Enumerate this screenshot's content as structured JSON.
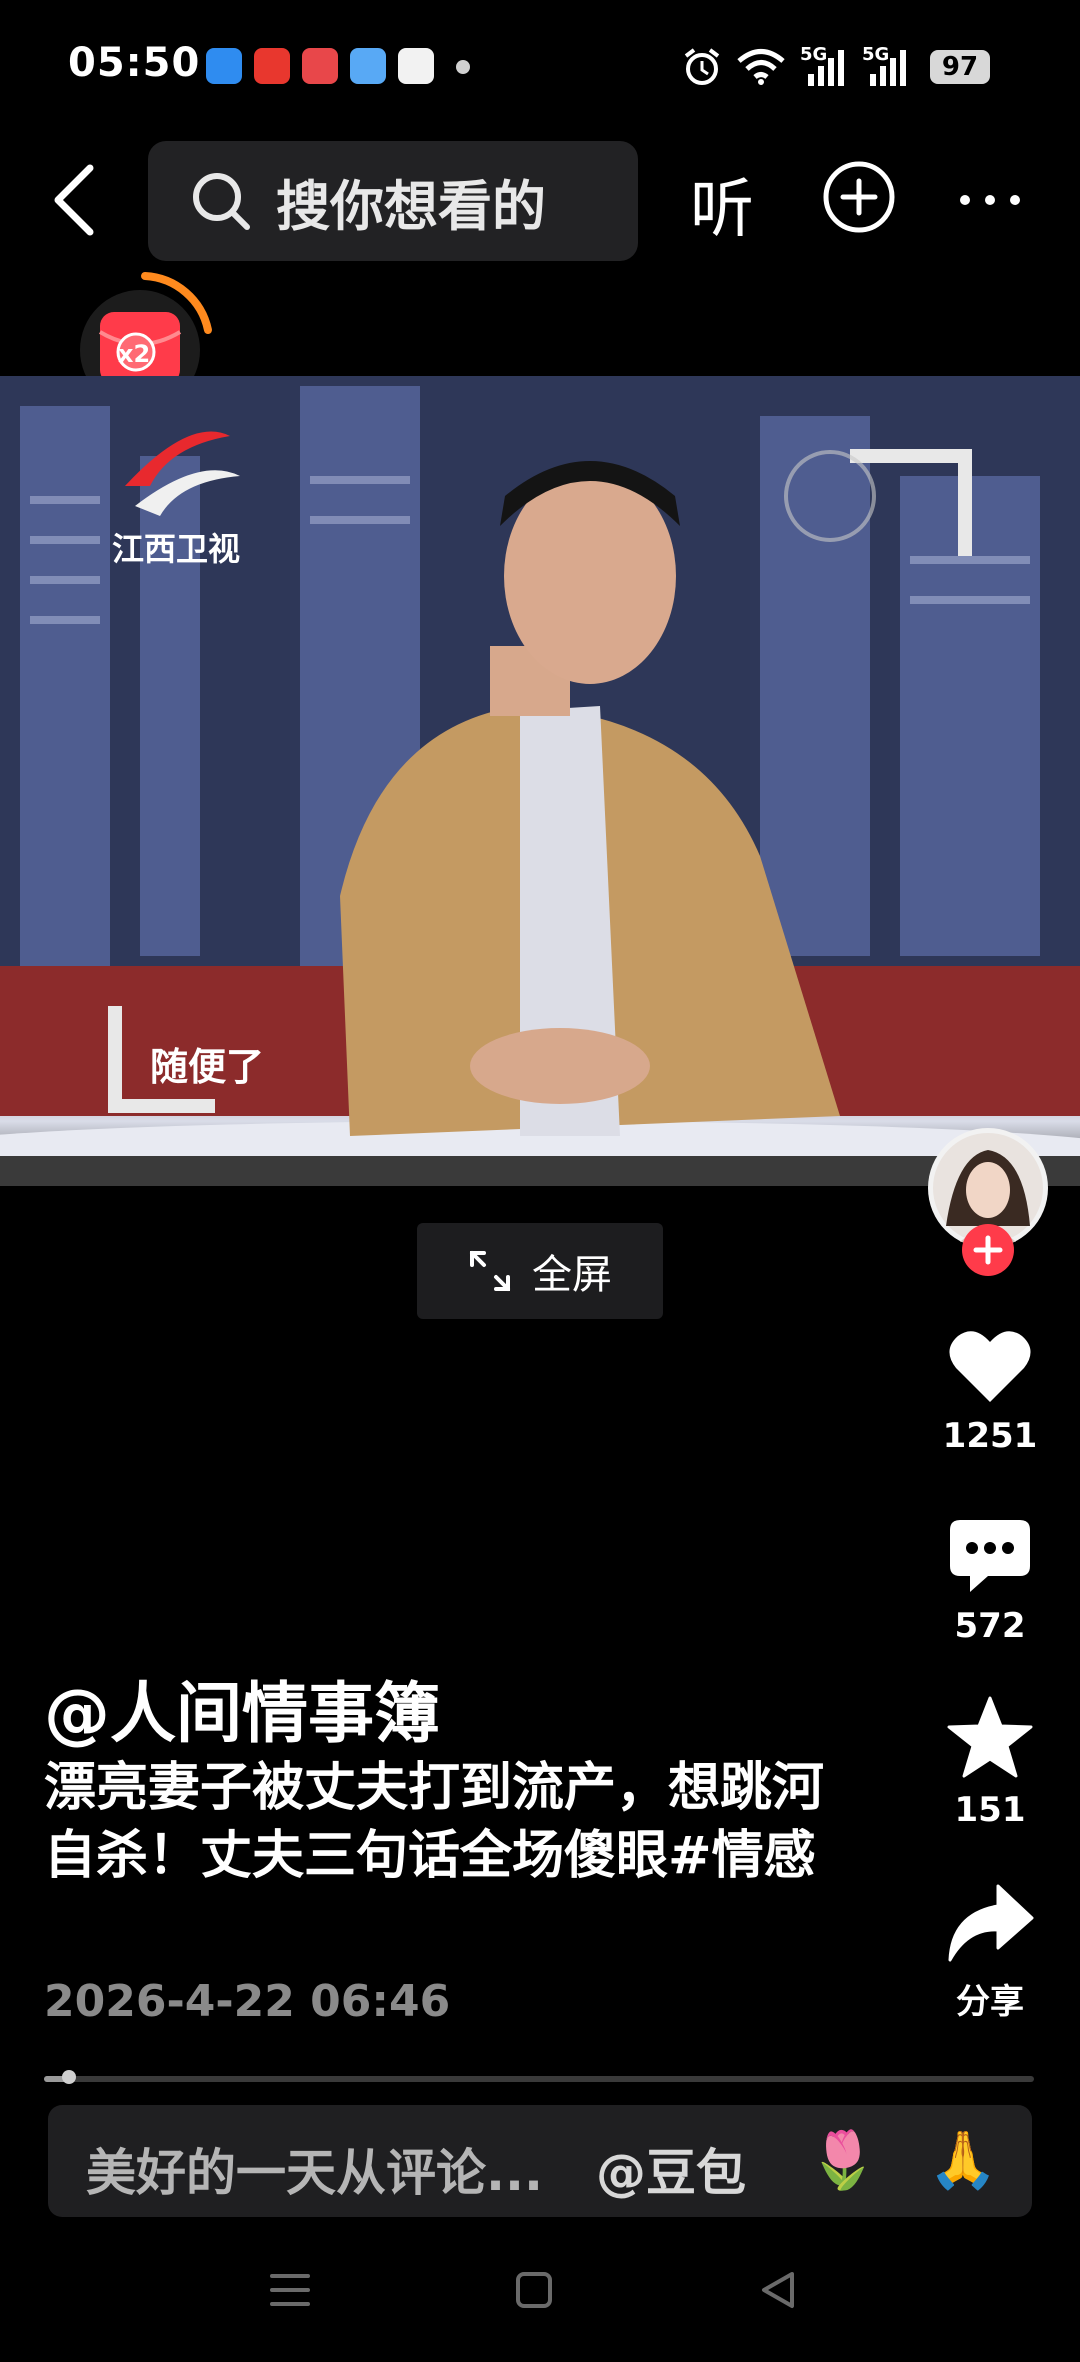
{
  "status_bar": {
    "time": "05:50",
    "app_icons": [
      "browser-icon",
      "toutiao-icon",
      "video-icon",
      "weather-icon",
      "clock-icon"
    ],
    "signal_labels": [
      "5G",
      "5G"
    ],
    "battery": "97"
  },
  "header": {
    "search_placeholder": "搜你想看的",
    "listen_label": "听"
  },
  "red_envelope": {
    "multiplier": "x2"
  },
  "video": {
    "channel_logo": "江西卫视",
    "subtitle": "随便了",
    "fullscreen_label": "全屏"
  },
  "rail": {
    "like_count": "1251",
    "comment_count": "572",
    "favorite_count": "151",
    "share_label": "分享"
  },
  "post": {
    "author": "@人间情事簿",
    "description": "漂亮妻子被丈夫打到流产，想跳河自杀！丈夫三句话全场傻眼",
    "hashtag": "#情感",
    "time": "2026-4-22 06:46",
    "progress_fraction": 0.025
  },
  "comment_bar": {
    "placeholder": "美好的一天从评论...",
    "mention": "@豆包",
    "emoji_1": "🌷",
    "emoji_2": "🙏"
  },
  "colors": {
    "accent_red": "#ff3b4a",
    "envelope_orange": "#ff8a1e",
    "bg": "#000000"
  }
}
